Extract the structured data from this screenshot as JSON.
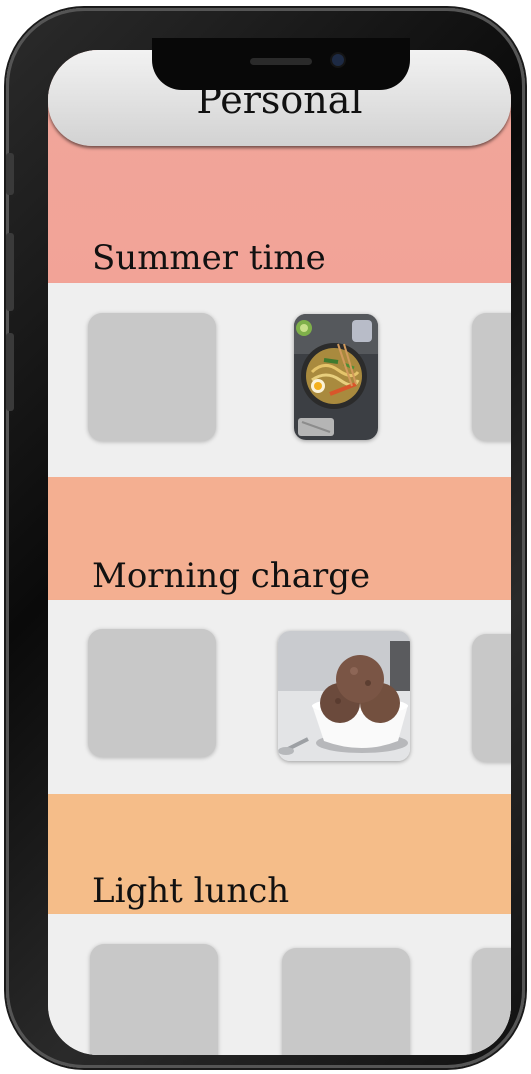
{
  "header": {
    "title": "Personal"
  },
  "sections": [
    {
      "title": "Summer time",
      "color": "#f2a79a",
      "photo": "noodle-bowl-photo"
    },
    {
      "title": "Morning charge",
      "color": "#f4b090",
      "photo": "chocolate-ice-cream-photo"
    },
    {
      "title": "Light lunch",
      "color": "#f5bd8a",
      "photo": null
    }
  ],
  "colors": {
    "tile": "#c8c8c8",
    "tray": "#efefef",
    "frame": "#111111"
  }
}
